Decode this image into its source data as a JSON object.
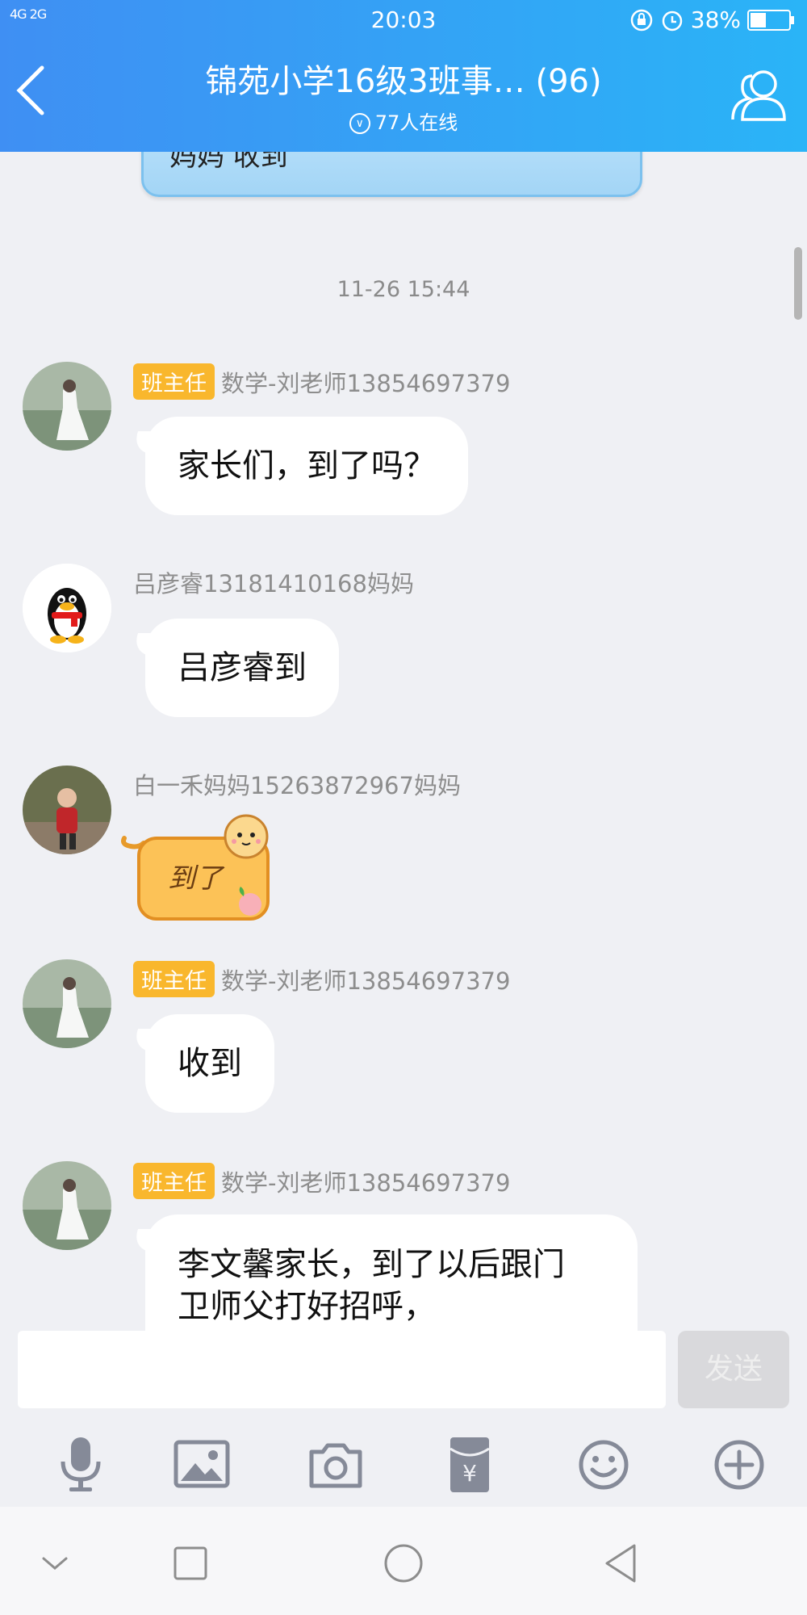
{
  "status_bar": {
    "network": "4G 2G",
    "time": "20:03",
    "battery": "38%"
  },
  "header": {
    "title": "锦苑小学16级3班事… (96)",
    "online": "77人在线"
  },
  "chat": {
    "previous_bubble_text": "妈妈 收到",
    "timestamp": "11-26 15:44",
    "messages": [
      {
        "badge": "班主任",
        "sender": "数学-刘老师13854697379",
        "text": "家长们，到了吗？"
      },
      {
        "badge": "",
        "sender": "吕彦睿13181410168妈妈",
        "text": "吕彦睿到"
      },
      {
        "badge": "",
        "sender": "白一禾妈妈15263872967妈妈",
        "sticker_text": "到了"
      },
      {
        "badge": "班主任",
        "sender": "数学-刘老师13854697379",
        "text": "收到"
      },
      {
        "badge": "班主任",
        "sender": "数学-刘老师13854697379",
        "text_line1": "李文馨家长，到了以后跟门",
        "text_line2": "卫师父打好招呼，"
      }
    ]
  },
  "input": {
    "value": "",
    "send_label": "发送"
  },
  "toolbar_icons": [
    "microphone-icon",
    "image-icon",
    "camera-icon",
    "red-packet-icon",
    "emoji-icon",
    "plus-icon"
  ],
  "nav_icons": [
    "chevron-down-icon",
    "recent-apps-icon",
    "home-icon",
    "back-triangle-icon"
  ]
}
